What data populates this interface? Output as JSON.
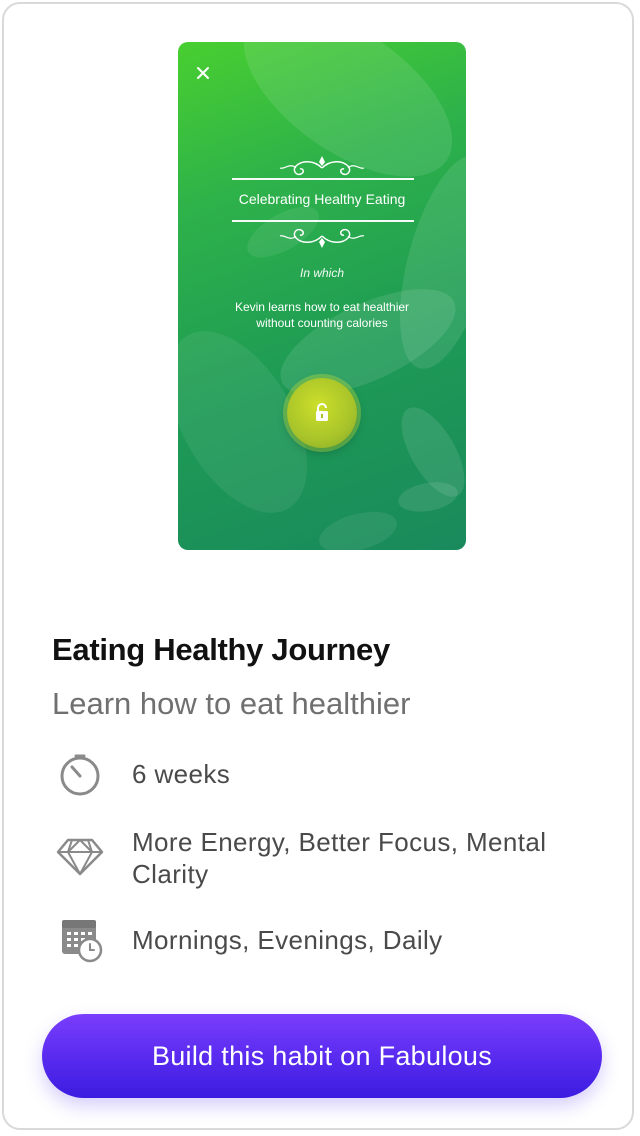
{
  "preview": {
    "story_title": "Celebrating Healthy Eating",
    "in_which": "In which",
    "description": "Kevin learns how to eat healthier without counting calories",
    "close_icon": "close-icon",
    "unlock_icon": "lock-icon",
    "colors": {
      "gradient_top": "#49cf30",
      "gradient_bottom": "#198a5c",
      "unlock_button": "#b6d12a"
    }
  },
  "journey": {
    "title": "Eating Healthy Journey",
    "subtitle": "Learn how to eat healthier"
  },
  "details": [
    {
      "icon": "timer-icon",
      "text": "6 weeks"
    },
    {
      "icon": "diamond-icon",
      "text": "More Energy, Better Focus, Mental Clarity"
    },
    {
      "icon": "calendar-clock-icon",
      "text": "Mornings, Evenings, Daily"
    }
  ],
  "cta": {
    "label": "Build this habit on Fabulous",
    "colors": {
      "start": "#7a3dfc",
      "end": "#3a1ce0"
    }
  }
}
